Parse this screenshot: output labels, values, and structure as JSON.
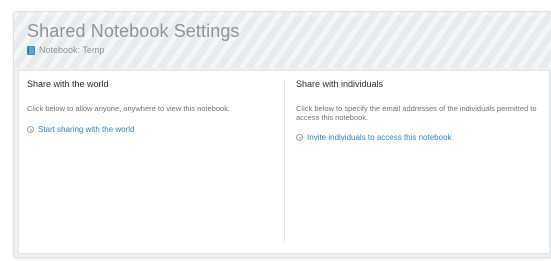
{
  "header": {
    "title": "Shared Notebook Settings",
    "notebook_label": "Notebook: Temp"
  },
  "world": {
    "title": "Share with the world",
    "description": "Click below to allow anyone, anywhere to view this notebook.",
    "action_label": "Start sharing with the world"
  },
  "individuals": {
    "title": "Share with individuals",
    "description": "Click below to specify the email addresses of the individuals permitted to access this notebook.",
    "action_label": "Invite individuals to access this notebook"
  },
  "icons": {
    "notebook": "notebook-icon",
    "action": "circle-bullet-icon"
  },
  "colors": {
    "link": "#2b8ac6",
    "title": "#8e959b",
    "notebook_icon": "#5aa7dc"
  }
}
